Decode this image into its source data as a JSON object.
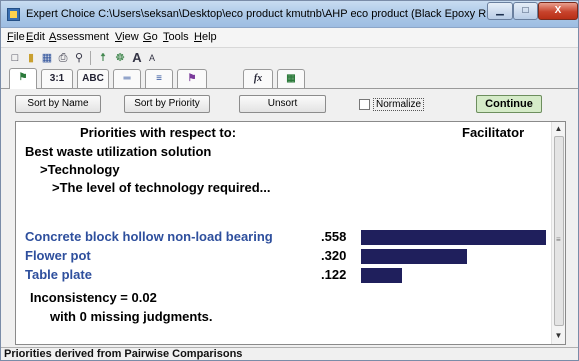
{
  "window": {
    "title": "Expert Choice    C:\\Users\\seksan\\Desktop\\eco product kmutnb\\AHP eco product (Black Epoxy Resin).ah...",
    "controls": {
      "minimize": "▁",
      "maximize": "□",
      "close": "X"
    }
  },
  "menu": [
    {
      "label": "File",
      "key": "F",
      "rest": "ile"
    },
    {
      "label": "Edit",
      "key": "E",
      "rest": "dit"
    },
    {
      "label": "Assessment",
      "key": "A",
      "rest": "ssessment"
    },
    {
      "label": "View",
      "key": "V",
      "rest": "iew"
    },
    {
      "label": "Go",
      "key": "G",
      "rest": "o"
    },
    {
      "label": "Tools",
      "key": "T",
      "rest": "ools"
    },
    {
      "label": "Help",
      "key": "H",
      "rest": "elp"
    }
  ],
  "toolbar_icons": [
    "new-file-icon",
    "open-folder-icon",
    "save-icon",
    "print-icon",
    "print-preview-icon",
    "tree-icon",
    "merge-icon",
    "font-larger-icon",
    "font-smaller-icon"
  ],
  "tabs": [
    {
      "label": "⚑",
      "name": "tab-tree"
    },
    {
      "label": "3:1",
      "name": "tab-numerical"
    },
    {
      "label": "ABC",
      "name": "tab-verbal"
    },
    {
      "label": "═",
      "name": "tab-graphical"
    },
    {
      "label": "≡",
      "name": "tab-questionnaire"
    },
    {
      "label": "⚑",
      "name": "tab-tree-2"
    },
    {
      "label": "fx",
      "name": "tab-formula"
    },
    {
      "label": "▦",
      "name": "tab-data-grid"
    }
  ],
  "commands": {
    "sort_by_name": "Sort by Name",
    "sort_by_priority": "Sort by Priority",
    "unsort": "Unsort",
    "normalize": "Normalize",
    "continue": "Continue"
  },
  "priorities": {
    "heading": "Priorities with respect to:",
    "right_heading": "Facilitator",
    "goal": "Best waste utilization solution",
    "level1": ">Technology",
    "level2": ">The level of technology required...",
    "alternatives": [
      {
        "name": "Concrete block hollow non-load bearing",
        "value": ".558",
        "priority": 0.558
      },
      {
        "name": "Flower pot",
        "value": ".320",
        "priority": 0.32
      },
      {
        "name": "Table plate",
        "value": ".122",
        "priority": 0.122
      }
    ],
    "inconsistency": "Inconsistency = 0.02",
    "missing": "with 0  missing judgments."
  },
  "colors": {
    "bar": "#1f1f5c",
    "alternative_text": "#2e4f9d",
    "continue_bg": "#d5ebc8"
  },
  "status": "Priorities derived from Pairwise Comparisons"
}
